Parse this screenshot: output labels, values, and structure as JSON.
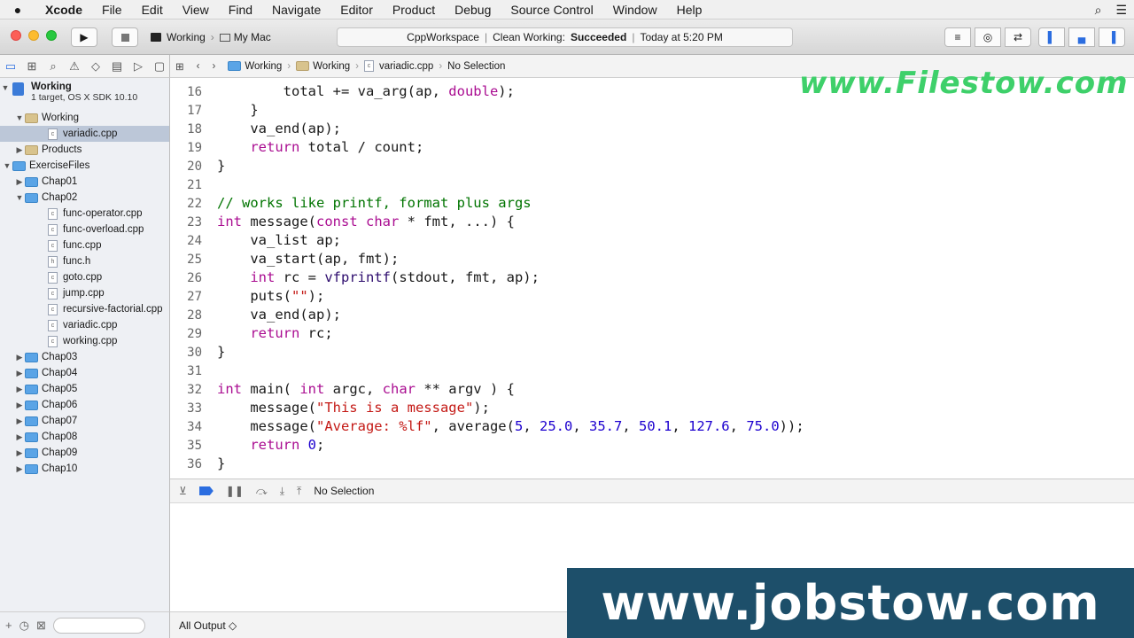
{
  "menubar": {
    "app": "Xcode",
    "items": [
      "File",
      "Edit",
      "View",
      "Find",
      "Navigate",
      "Editor",
      "Product",
      "Debug",
      "Source Control",
      "Window",
      "Help"
    ]
  },
  "toolbar": {
    "scheme": "Working",
    "destination": "My Mac",
    "status_workspace": "CppWorkspace",
    "status_prefix": "Clean Working:",
    "status_result": "Succeeded",
    "status_time": "Today at 5:20 PM"
  },
  "navigator": {
    "project": "Working",
    "project_sub": "1 target, OS X SDK 10.10",
    "tree": [
      {
        "label": "Working",
        "indent": 1,
        "kind": "folder-yellow",
        "open": true
      },
      {
        "label": "variadic.cpp",
        "indent": 2,
        "kind": "file",
        "selected": true
      },
      {
        "label": "Products",
        "indent": 1,
        "kind": "folder-yellow",
        "open": false
      },
      {
        "label": "ExerciseFiles",
        "indent": 0,
        "kind": "folder-blue",
        "open": true
      },
      {
        "label": "Chap01",
        "indent": 1,
        "kind": "folder-blue",
        "open": false
      },
      {
        "label": "Chap02",
        "indent": 1,
        "kind": "folder-blue",
        "open": true
      },
      {
        "label": "func-operator.cpp",
        "indent": 2,
        "kind": "file"
      },
      {
        "label": "func-overload.cpp",
        "indent": 2,
        "kind": "file"
      },
      {
        "label": "func.cpp",
        "indent": 2,
        "kind": "file"
      },
      {
        "label": "func.h",
        "indent": 2,
        "kind": "header"
      },
      {
        "label": "goto.cpp",
        "indent": 2,
        "kind": "file"
      },
      {
        "label": "jump.cpp",
        "indent": 2,
        "kind": "file"
      },
      {
        "label": "recursive-factorial.cpp",
        "indent": 2,
        "kind": "file"
      },
      {
        "label": "variadic.cpp",
        "indent": 2,
        "kind": "file"
      },
      {
        "label": "working.cpp",
        "indent": 2,
        "kind": "file"
      },
      {
        "label": "Chap03",
        "indent": 1,
        "kind": "folder-blue",
        "open": false
      },
      {
        "label": "Chap04",
        "indent": 1,
        "kind": "folder-blue",
        "open": false
      },
      {
        "label": "Chap05",
        "indent": 1,
        "kind": "folder-blue",
        "open": false
      },
      {
        "label": "Chap06",
        "indent": 1,
        "kind": "folder-blue",
        "open": false
      },
      {
        "label": "Chap07",
        "indent": 1,
        "kind": "folder-blue",
        "open": false
      },
      {
        "label": "Chap08",
        "indent": 1,
        "kind": "folder-blue",
        "open": false
      },
      {
        "label": "Chap09",
        "indent": 1,
        "kind": "folder-blue",
        "open": false
      },
      {
        "label": "Chap10",
        "indent": 1,
        "kind": "folder-blue",
        "open": false
      }
    ]
  },
  "jumpbar": {
    "crumbs": [
      "Working",
      "Working",
      "variadic.cpp",
      "No Selection"
    ]
  },
  "editor": {
    "lines": [
      {
        "n": "16",
        "html": "        total += va_arg(ap, <span class=\"kw\">double</span>);"
      },
      {
        "n": "17",
        "html": "    }"
      },
      {
        "n": "18",
        "html": "    va_end(ap);"
      },
      {
        "n": "19",
        "html": "    <span class=\"kw\">return</span> total / count;"
      },
      {
        "n": "20",
        "html": "}"
      },
      {
        "n": "21",
        "html": ""
      },
      {
        "n": "22",
        "html": "<span class=\"cm\">// works like printf, format plus args</span>"
      },
      {
        "n": "23",
        "html": "<span class=\"kw\">int</span> message(<span class=\"kw\">const</span> <span class=\"kw\">char</span> * fmt, ...) {"
      },
      {
        "n": "24",
        "html": "    va_list ap;"
      },
      {
        "n": "25",
        "html": "    va_start(ap, fmt);"
      },
      {
        "n": "26",
        "html": "    <span class=\"kw\">int</span> rc = <span class=\"fn\">vfprintf</span>(stdout, fmt, ap);"
      },
      {
        "n": "27",
        "html": "    puts(<span class=\"str\">\"\"</span>);"
      },
      {
        "n": "28",
        "html": "    va_end(ap);"
      },
      {
        "n": "29",
        "html": "    <span class=\"kw\">return</span> rc;"
      },
      {
        "n": "30",
        "html": "}"
      },
      {
        "n": "31",
        "html": ""
      },
      {
        "n": "32",
        "html": "<span class=\"kw\">int</span> main( <span class=\"kw\">int</span> argc, <span class=\"kw\">char</span> ** argv ) {"
      },
      {
        "n": "33",
        "html": "    message(<span class=\"str\">\"This is a message\"</span>);"
      },
      {
        "n": "34",
        "html": "    message(<span class=\"str\">\"Average: %lf\"</span>, average(<span class=\"num\">5</span>, <span class=\"num\">25.0</span>, <span class=\"num\">35.7</span>, <span class=\"num\">50.1</span>, <span class=\"num\">127.6</span>, <span class=\"num\">75.0</span>));"
      },
      {
        "n": "35",
        "html": "    <span class=\"kw\">return</span> <span class=\"num\">0</span>;"
      },
      {
        "n": "36",
        "html": "}"
      }
    ]
  },
  "debug": {
    "selection": "No Selection"
  },
  "console": {
    "output_selector": "All Output ◇"
  },
  "watermarks": {
    "top": "www.Filestow.com",
    "bottom": "www.jobstow.com"
  }
}
